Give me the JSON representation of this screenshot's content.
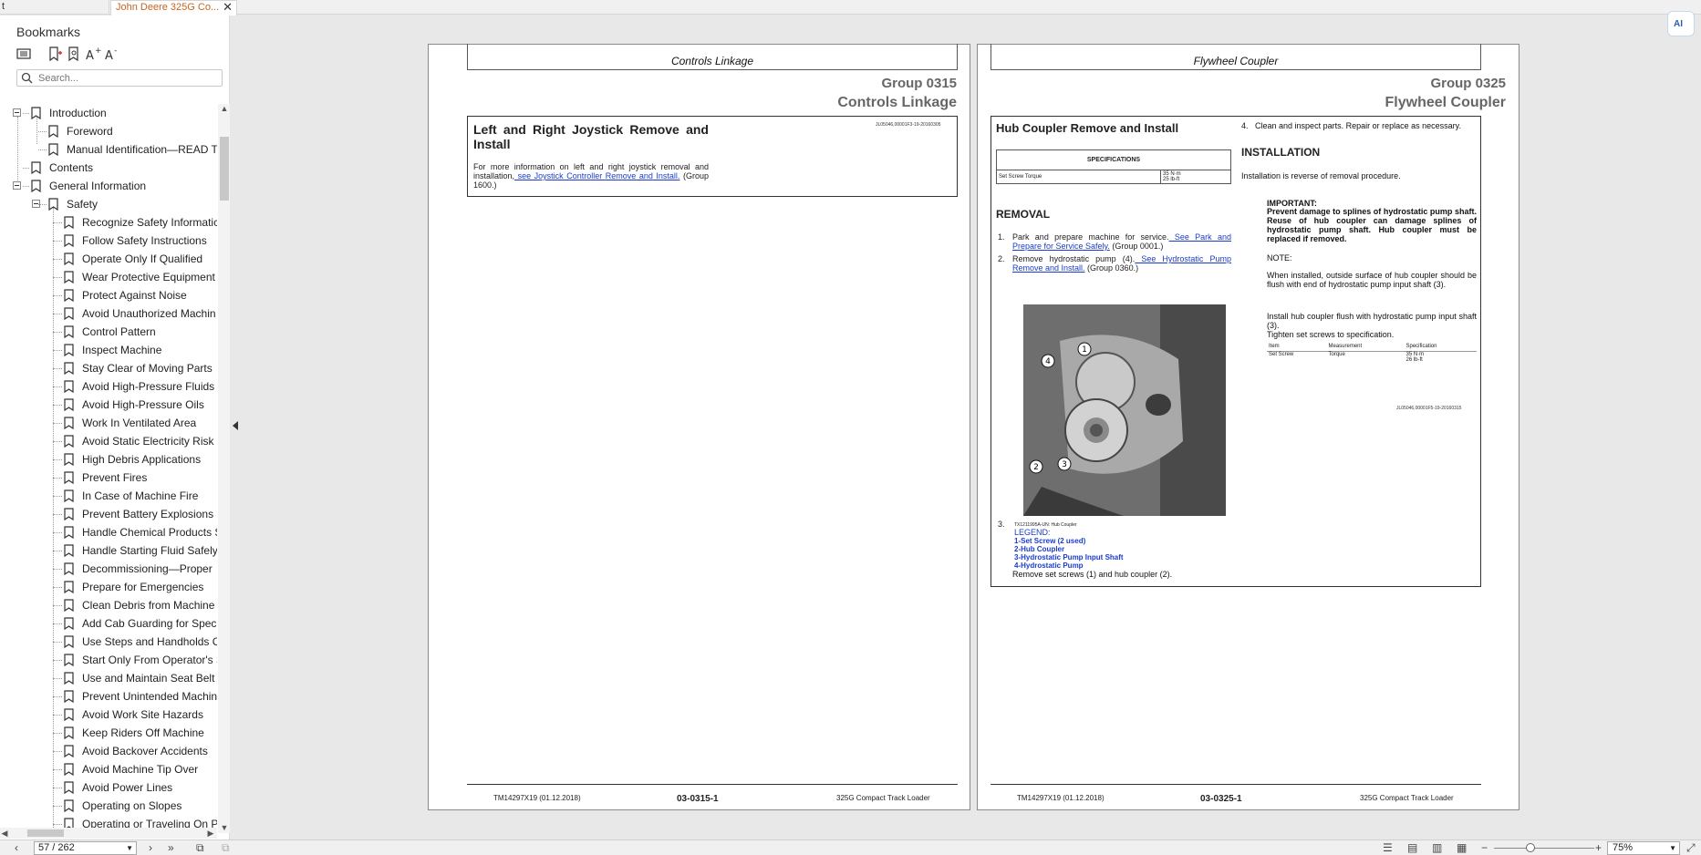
{
  "tabs": {
    "prev_label": "t",
    "active_label": "John Deere 325G Co...",
    "close": "✕"
  },
  "sidebar": {
    "title": "Bookmarks",
    "search_placeholder": "Search...",
    "items": [
      {
        "label": "Introduction"
      },
      {
        "label": "Foreword"
      },
      {
        "label": "Manual Identification—READ TI"
      },
      {
        "label": "Contents"
      },
      {
        "label": "General Information"
      },
      {
        "label": "Safety"
      },
      {
        "label": "Recognize Safety Informatic"
      },
      {
        "label": "Follow Safety Instructions"
      },
      {
        "label": "Operate Only If Qualified"
      },
      {
        "label": "Wear Protective Equipment"
      },
      {
        "label": "Protect Against Noise"
      },
      {
        "label": "Avoid Unauthorized Machin"
      },
      {
        "label": "Control Pattern"
      },
      {
        "label": "Inspect Machine"
      },
      {
        "label": "Stay Clear of Moving Parts"
      },
      {
        "label": "Avoid High-Pressure Fluids"
      },
      {
        "label": "Avoid High-Pressure Oils"
      },
      {
        "label": "Work In Ventilated Area"
      },
      {
        "label": "Avoid Static Electricity Risk V"
      },
      {
        "label": "High Debris Applications"
      },
      {
        "label": "Prevent Fires"
      },
      {
        "label": "In Case of Machine Fire"
      },
      {
        "label": "Prevent Battery Explosions"
      },
      {
        "label": "Handle Chemical Products S"
      },
      {
        "label": "Handle Starting Fluid Safely"
      },
      {
        "label": "Decommissioning—Proper"
      },
      {
        "label": "Prepare for Emergencies"
      },
      {
        "label": "Clean Debris from Machine"
      },
      {
        "label": "Add Cab Guarding for Speci"
      },
      {
        "label": "Use Steps and Handholds C"
      },
      {
        "label": "Start Only From Operator's S"
      },
      {
        "label": "Use and Maintain Seat Belt"
      },
      {
        "label": "Prevent Unintended Machin"
      },
      {
        "label": "Avoid Work Site Hazards"
      },
      {
        "label": "Keep Riders Off Machine"
      },
      {
        "label": "Avoid Backover Accidents"
      },
      {
        "label": "Avoid Machine Tip Over"
      },
      {
        "label": "Avoid Power Lines"
      },
      {
        "label": "Operating on Slopes"
      },
      {
        "label": "Operating or Traveling On P"
      }
    ]
  },
  "page1": {
    "header": "Controls Linkage",
    "group_num": "Group 0315",
    "group_name": "Controls Linkage",
    "section_title": "Left and Right Joystick Remove and Install",
    "ref": "JL05046,00001F3-19-20160305",
    "body_pre": "For more information on left and right joystick removal and installation,",
    "body_link": " see Joystick Controller Remove and Install.",
    "body_post": " (Group 1600.)",
    "footer_left": "TM14297X19 (01.12.2018)",
    "footer_mid": "03-0315-1",
    "footer_right": "325G Compact Track Loader"
  },
  "page2": {
    "header": "Flywheel Coupler",
    "group_num": "Group 0325",
    "group_name": "Flywheel Coupler",
    "section_title": "Hub Coupler Remove and Install",
    "spec_header": "SPECIFICATIONS",
    "spec_item": "Set Screw Torque",
    "spec_v1": "35 N·m",
    "spec_v2": "25 lb-ft",
    "removal_heading": "REMOVAL",
    "step1_pre": "Park and prepare machine for service.",
    "step1_link": " See Park and Prepare for Service Safely.",
    "step1_post": " (Group 0001.)",
    "step2_pre": "Remove hydrostatic pump (4).",
    "step2_link": " See Hydrostatic Pump Remove and Install.",
    "step2_post": " (Group 0360.)",
    "callouts": [
      "1",
      "2",
      "3",
      "4"
    ],
    "caption_ref": "TX1211995A-UN: Hub Coupler",
    "legend_label": "LEGEND:",
    "legend_items": [
      "1-Set Screw (2 used)",
      "2-Hub Coupler",
      "3-Hydrostatic Pump Input Shaft",
      "4-Hydrostatic Pump"
    ],
    "step3": "Remove set screws (1) and hub coupler (2).",
    "step4": "Clean and inspect parts. Repair or replace as necessary.",
    "install_heading": "INSTALLATION",
    "install_text": "Installation is reverse of removal procedure.",
    "important_label": "IMPORTANT:",
    "important_text": "Prevent damage to splines of hydrostatic pump shaft. Reuse of hub coupler can damage splines of hydrostatic pump shaft. Hub coupler must be replaced if removed.",
    "note_label": "NOTE:",
    "note_text": "When installed, outside surface of hub coupler should be flush with end of hydrostatic pump input shaft (3).",
    "install_step": "Install hub coupler flush with hydrostatic pump input shaft (3).",
    "tighten": "Tighten set screws to specification.",
    "mini_headers": [
      "Item",
      "Measurement",
      "Specification"
    ],
    "mini_row": [
      "Set Screw",
      "Torque",
      "35 N·m",
      "26 lb-ft"
    ],
    "ref": "JL05046,00001F5-19-20160315",
    "footer_left": "TM14297X19 (01.12.2018)",
    "footer_mid": "03-0325-1",
    "footer_right": "325G Compact Track Loader"
  },
  "bottombar": {
    "page_indicator": "57 / 262",
    "zoom": "75%"
  },
  "ai_label": "AI"
}
